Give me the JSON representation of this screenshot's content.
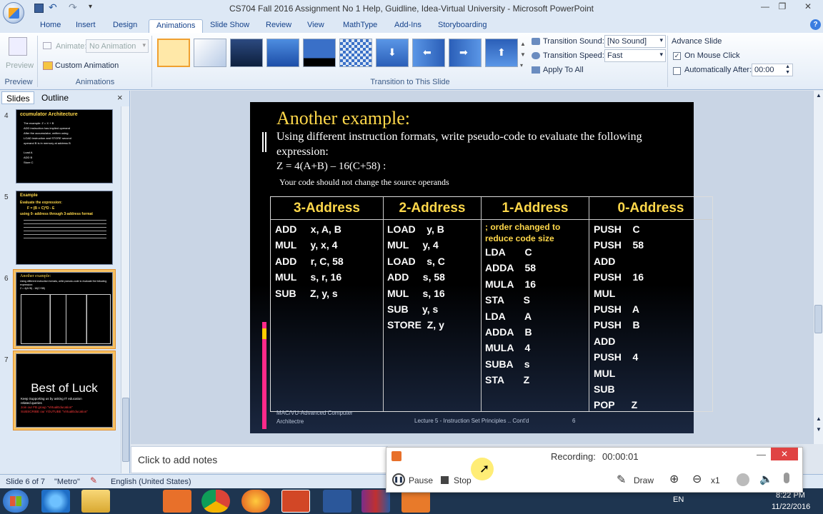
{
  "window": {
    "title": "CS704 Fall 2016 Assignment No 1 Help, Guidline, Idea-Virtual University - Microsoft PowerPoint"
  },
  "tabs": [
    "Home",
    "Insert",
    "Design",
    "Animations",
    "Slide Show",
    "Review",
    "View",
    "MathType",
    "Add-Ins",
    "Storyboarding"
  ],
  "ribbon": {
    "preview_label": "Preview",
    "animate_label": "Animate:",
    "animate_value": "No Animation",
    "custom_animation": "Custom Animation",
    "group_preview": "Preview",
    "group_animations": "Animations",
    "transition_sound_label": "Transition Sound:",
    "transition_sound_value": "[No Sound]",
    "transition_speed_label": "Transition Speed:",
    "transition_speed_value": "Fast",
    "apply_all": "Apply To All",
    "group_transition": "Transition to This Slide",
    "advance_slide": "Advance Slide",
    "on_mouse_click": "On Mouse Click",
    "auto_after": "Automatically After:",
    "auto_after_value": "00:00"
  },
  "panel": {
    "tab_slides": "Slides",
    "tab_outline": "Outline",
    "close": "×"
  },
  "thumbs": [
    {
      "num": "4",
      "title": "ccumulator  Architecture",
      "lines": [
        "The example: Z = X + B",
        "ADD instruction has implied operand",
        "After the accumulator, written using",
        "LOAD instruction and STORE second",
        "operand B is in memory at address B",
        "",
        "Load A",
        "ADD B",
        "Store C"
      ]
    },
    {
      "num": "5",
      "title": "Example",
      "lines": [
        "Evaluate the expression:",
        "F = (B + C)*D - E",
        "using 0- address through 3-address format"
      ]
    },
    {
      "num": "6",
      "title": "Another example:",
      "lines": [
        "Using different instruction formats, write pseudo-code to evaluate the following",
        "expression:",
        "Z = 4(A+B) - 16(C+58)"
      ]
    },
    {
      "num": "7",
      "title": "Best of Luck",
      "lines": [
        "Keep Supporting us by asking IT education",
        "related queries",
        "Join our FB group \"VirtualEducation\"",
        "SUBSCRIBE our YOUTUBE \"VirtualEducation\""
      ]
    }
  ],
  "slide": {
    "title": "Another example:",
    "line1": "Using different instruction formats, write pseudo-code to evaluate the following",
    "line2": "expression:",
    "expr": "Z = 4(A+B) – 16(C+58) :",
    "note": "Your code should not change the source operands",
    "headers": [
      "3-Address",
      "2-Address",
      "1-Address",
      "0-Address"
    ],
    "col3": [
      "ADD     x, A, B",
      "MUL     y, x, 4",
      "ADD     r, C, 58",
      "MUL     s, r, 16",
      "SUB     Z, y, s"
    ],
    "col2": [
      "LOAD    y, B",
      "MUL     y, 4",
      "LOAD    s, C",
      "ADD     s, 58",
      "MUL     s, 16",
      "SUB     y, s",
      "STORE  Z, y"
    ],
    "col1_comment": [
      "; order changed to",
      "reduce code size"
    ],
    "col1": [
      "LDA       C",
      "ADDA    58",
      "MULA    16",
      "STA       S",
      "LDA       A",
      "ADDA    B",
      "MULA    4",
      "SUBA    s",
      "STA       Z"
    ],
    "col0": [
      "PUSH    C",
      "PUSH    58",
      "ADD",
      "PUSH    16",
      "MUL",
      "PUSH    A",
      "PUSH    B",
      "ADD",
      "PUSH    4",
      "MUL",
      "SUB",
      "POP      Z"
    ],
    "footer_left1": "MAC/VU-Advanced Computer",
    "footer_left2": "Architectre",
    "footer_mid": "Lecture 5 - Instruction Set Principles .. Cont'd",
    "footer_page": "6"
  },
  "notes": "Click to add notes",
  "status": {
    "slide": "Slide 6 of 7",
    "theme": "\"Metro\"",
    "language": "English (United States)"
  },
  "recorder": {
    "title": "Recording:",
    "time": "00:00:01",
    "pause": "Pause",
    "stop": "Stop",
    "draw": "Draw",
    "zoom": "x1"
  },
  "tray": {
    "lang": "EN",
    "time": "8:22 PM",
    "date": "11/22/2016"
  }
}
